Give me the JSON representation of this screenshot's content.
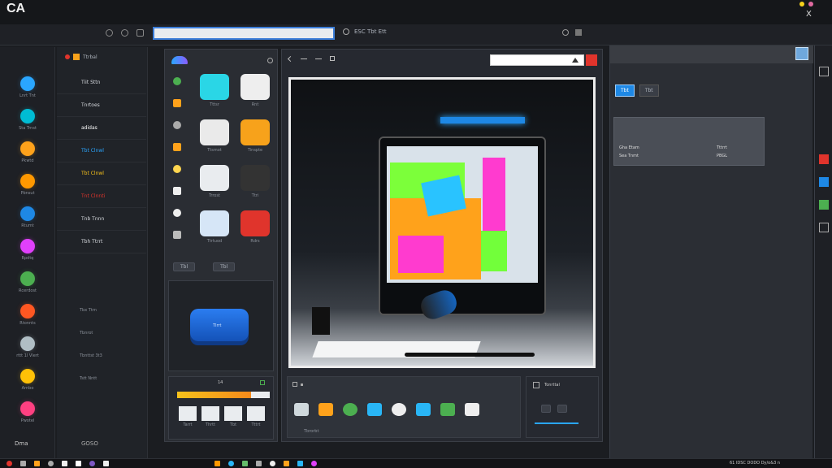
{
  "app": {
    "logo": "CA",
    "colors": {
      "accent": "#2aa6ff",
      "orange": "#f7a21b",
      "red": "#e0342c",
      "bg": "#1b1d21",
      "panel": "#2a2d33"
    },
    "window_close": "X"
  },
  "top_tabs": {
    "tab_center": "ESC Tbt Ett"
  },
  "left_rail": {
    "items": [
      {
        "icon": "blue-globe-icon",
        "label": "Lnrt Tnt"
      },
      {
        "icon": "teal-globe-icon",
        "label": "Sta Trnst"
      },
      {
        "icon": "orange-chat-icon",
        "label": "Pkwtd"
      },
      {
        "icon": "orange-circle-icon",
        "label": "Pbnsut"
      },
      {
        "icon": "blue-sync-icon",
        "label": "Rtumt"
      },
      {
        "icon": "magenta-flower-icon",
        "label": "Rpdtq"
      },
      {
        "icon": "green-circle-icon",
        "label": "Rcerdost"
      },
      {
        "icon": "orange-shape-icon",
        "label": "Rtonnts"
      },
      {
        "icon": "ring-icon",
        "label": "rttt 1l Vlert"
      },
      {
        "icon": "yellow-bulb-icon",
        "label": "Arnbo"
      },
      {
        "icon": "pink-bird-icon",
        "label": "Pwotel"
      }
    ],
    "footer": "Dma"
  },
  "nav_list": {
    "header": "Ttrbal",
    "items": [
      {
        "label": "Tiit Sttn",
        "color": "#d6d9de"
      },
      {
        "label": "Tnrtoes",
        "color": "#d6d9de"
      },
      {
        "label": "adidas",
        "color": "#ffffff"
      },
      {
        "label": "Tbt Clnwl",
        "color": "#2aa6ff"
      },
      {
        "label": "Tbt Clnwl",
        "color": "#f7c21b"
      },
      {
        "label": "Tnt Clnnti",
        "color": "#e0342c"
      },
      {
        "label": "Tnb Tnnn",
        "color": "#d6d9de"
      },
      {
        "label": "Tbh Ttrrt",
        "color": "#d6d9de"
      }
    ],
    "meta_rows": [
      "Tbx Ttrn",
      "Tbnrot",
      "Tbnttst 3t3",
      "Tstt Nntt"
    ],
    "bottom": "GOSO"
  },
  "icon_panel": {
    "left_icons": [
      "circle-icon",
      "moon-icon",
      "grid-icon",
      "box-icon",
      "moon-icon",
      "square-icon",
      "refresh-icon",
      "dot-icon"
    ],
    "tiles": [
      {
        "name": "cloud-tile",
        "label": "Tttsr"
      },
      {
        "name": "chart-tile",
        "label": "Rnt"
      },
      {
        "name": "server-tile",
        "label": "Ttsmot"
      },
      {
        "name": "orange-app-tile",
        "label": "Tinspte"
      },
      {
        "name": "screen-tile",
        "label": "Trrost"
      },
      {
        "name": "dots-tile",
        "label": "Ttri"
      },
      {
        "name": "blue-arch-tile",
        "label": "Ttrtuod"
      },
      {
        "name": "red-app-tile",
        "label": "Rdrs"
      }
    ],
    "button_a": "Tbl",
    "button_b": "Tbl",
    "cube_label": "Tlrrt",
    "timeline_count": "14",
    "thumbs": [
      "Tarrt",
      "Thrtt",
      "Tbt",
      "Tttrt"
    ]
  },
  "viewer": {
    "search_placeholder": "",
    "tab_label": "ESC",
    "toolbar_icons": [
      "image-icon",
      "bookmark-icon",
      "color-wheel-icon",
      "cloud-icon",
      "record-icon",
      "columns-icon",
      "monitor-icon",
      "arch-icon"
    ],
    "bottom_label": "Tbrorbt",
    "right_title": "Tonrttal"
  },
  "right_pane": {
    "buttons": [
      "Tbt",
      "Tbt"
    ],
    "card_label_left": "Gha Etam",
    "card_label_left2": "Sea Tnmt",
    "card_label_right": "Tttrrt",
    "card_label_right2": "PBGL"
  },
  "status_bar": {
    "right_text": "61 IDSC DODO Dy/o&3 n"
  }
}
